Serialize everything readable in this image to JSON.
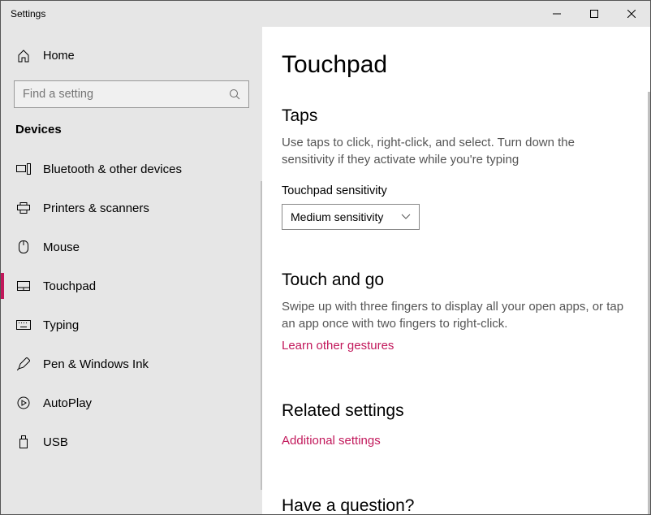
{
  "window": {
    "title": "Settings"
  },
  "sidebar": {
    "home": "Home",
    "search_placeholder": "Find a setting",
    "section": "Devices",
    "items": [
      {
        "label": "Bluetooth & other devices"
      },
      {
        "label": "Printers & scanners"
      },
      {
        "label": "Mouse"
      },
      {
        "label": "Touchpad"
      },
      {
        "label": "Typing"
      },
      {
        "label": "Pen & Windows Ink"
      },
      {
        "label": "AutoPlay"
      },
      {
        "label": "USB"
      }
    ]
  },
  "main": {
    "title": "Touchpad",
    "taps": {
      "heading": "Taps",
      "desc": "Use taps to click, right-click, and select. Turn down the sensitivity if they activate while you're typing",
      "sensitivity_label": "Touchpad sensitivity",
      "sensitivity_value": "Medium sensitivity"
    },
    "touch_and_go": {
      "heading": "Touch and go",
      "desc": "Swipe up with three fingers to display all your open apps, or tap an app once with two fingers to right-click.",
      "link": "Learn other gestures"
    },
    "related": {
      "heading": "Related settings",
      "link": "Additional settings"
    },
    "question": {
      "heading": "Have a question?"
    }
  }
}
